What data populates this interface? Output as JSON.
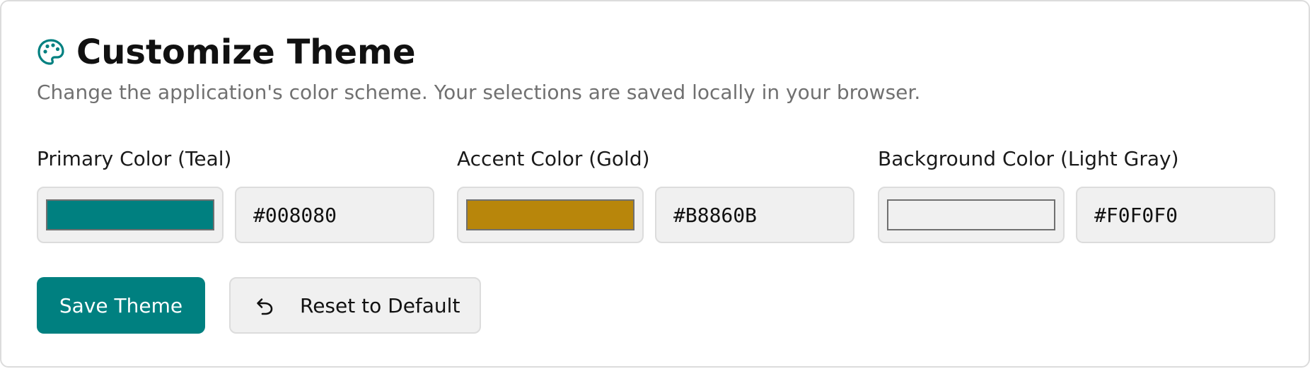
{
  "header": {
    "title": "Customize Theme",
    "subtitle": "Change the application's color scheme. Your selections are saved locally in your browser.",
    "icon": "palette-icon"
  },
  "colors": [
    {
      "label": "Primary Color (Teal)",
      "value": "#008080"
    },
    {
      "label": "Accent Color (Gold)",
      "value": "#B8860B"
    },
    {
      "label": "Background Color (Light Gray)",
      "value": "#F0F0F0"
    }
  ],
  "actions": {
    "save_label": "Save Theme",
    "reset_label": "Reset to Default",
    "reset_icon": "undo-icon"
  },
  "theme": {
    "accent": "#008080",
    "icon_color": "#008080"
  }
}
